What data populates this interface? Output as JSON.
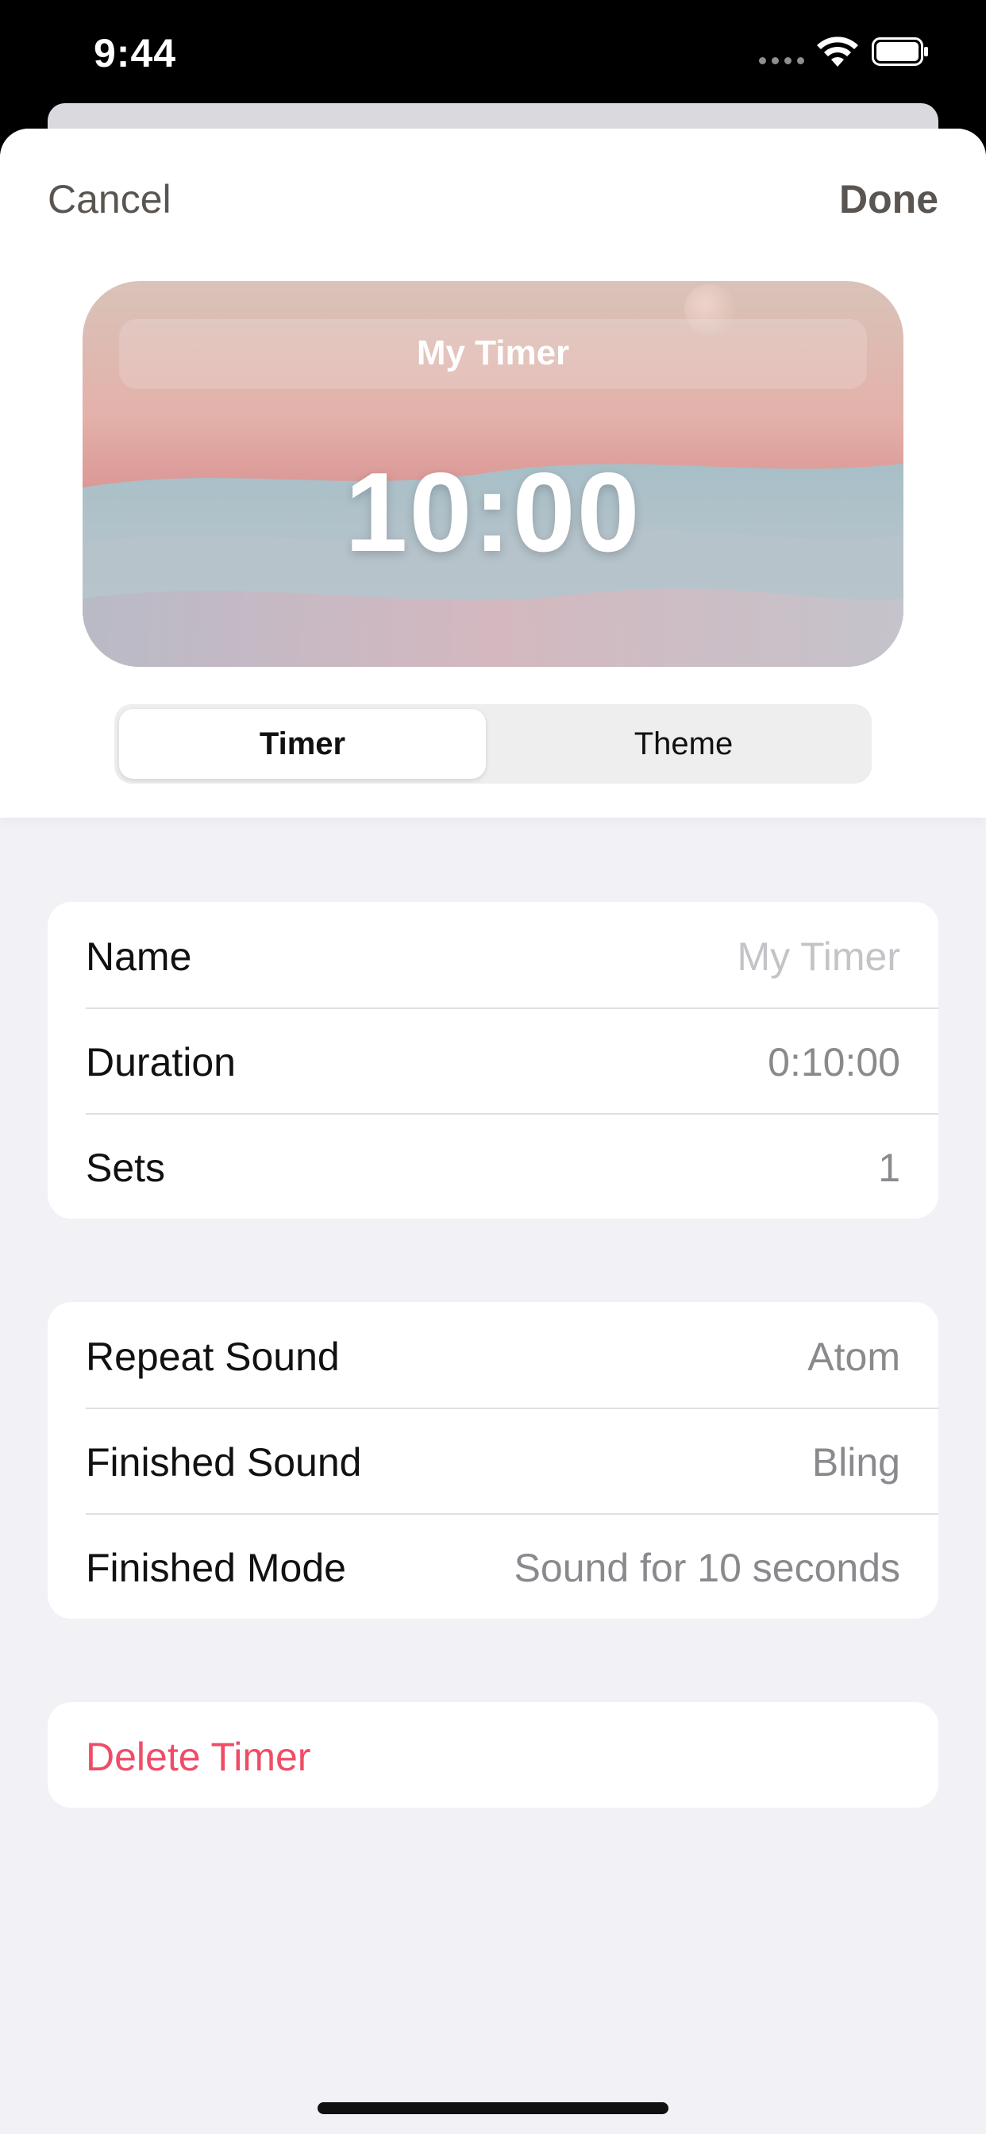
{
  "status_bar": {
    "time": "9:44",
    "icons": [
      "cellular-signal-icon",
      "wifi-icon",
      "battery-icon"
    ]
  },
  "nav": {
    "cancel_label": "Cancel",
    "done_label": "Done"
  },
  "preview": {
    "timer_name": "My Timer",
    "time": "10:00",
    "theme": "pink desert dunes"
  },
  "segmented_control": {
    "options": [
      "Timer",
      "Theme"
    ],
    "selected": "Timer"
  },
  "timer_settings": {
    "name": {
      "label": "Name",
      "placeholder": "My Timer"
    },
    "duration": {
      "label": "Duration",
      "value": "0:10:00"
    },
    "sets": {
      "label": "Sets",
      "value": "1"
    }
  },
  "sound_settings": {
    "repeat_sound": {
      "label": "Repeat Sound",
      "value": "Atom"
    },
    "finished_sound": {
      "label": "Finished Sound",
      "value": "Bling"
    },
    "finished_mode": {
      "label": "Finished Mode",
      "value": "Sound for 10 seconds"
    }
  },
  "delete": {
    "label": "Delete Timer"
  },
  "colors": {
    "accent_text": "#5a5550",
    "destructive": "#ef4d66",
    "background": "#f2f1f6",
    "secondary_text": "#8a8a8e"
  }
}
